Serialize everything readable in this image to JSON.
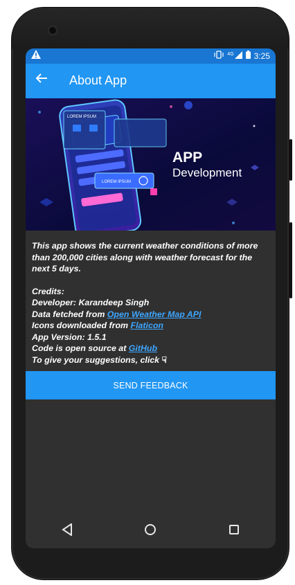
{
  "status_bar": {
    "warning_icon": "warning-icon",
    "network_label": "4G",
    "time": "3:25"
  },
  "app_bar": {
    "back_icon": "arrow-left-icon",
    "title": "About App"
  },
  "banner": {
    "title_line1": "APP",
    "title_line2": "Development",
    "card_text1": "LOREM IPSUM",
    "card_text2": "LOREM IPSUM"
  },
  "content": {
    "description": "This app shows the current weather conditions of more than 200,000 cities along with weather forecast for the next 5 days.",
    "credits_heading": "Credits:",
    "developer": "Developer: Karandeep Singh",
    "data_prefix": "Data fetched from ",
    "data_link": "Open Weather Map API",
    "icons_prefix": "Icons downloaded from ",
    "icons_link": "Flaticon",
    "version": "App Version: 1.5.1",
    "code_prefix": " Code is open source at ",
    "code_link": "GitHub",
    "suggestions": "To give your suggestions, click "
  },
  "feedback_button": "SEND FEEDBACK",
  "nav_bar": {
    "back": "triangle-back-icon",
    "home": "circle-home-icon",
    "recents": "square-recents-icon"
  }
}
